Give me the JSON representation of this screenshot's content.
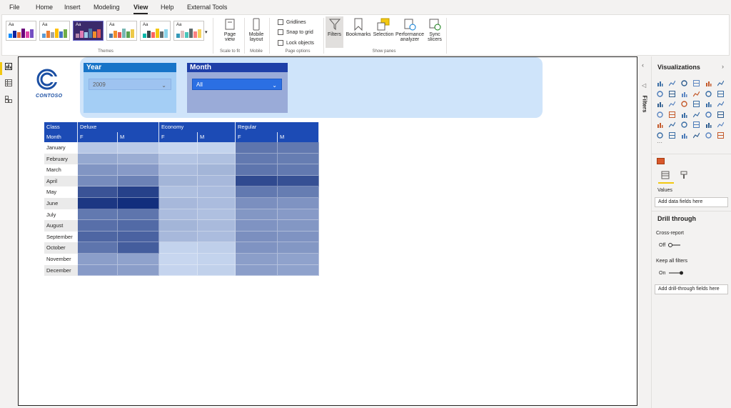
{
  "menu": [
    "File",
    "Home",
    "Insert",
    "Modeling",
    "View",
    "Help",
    "External Tools"
  ],
  "menu_active": "View",
  "ribbon": {
    "themes_label": "Themes",
    "page_view_label": "Page view",
    "scale_label": "Scale to fit",
    "mobile_layout_label": "Mobile layout",
    "mobile_label": "Mobile",
    "page_options_label": "Page options",
    "gridlines_label": "Gridlines",
    "snap_label": "Snap to grid",
    "lock_label": "Lock objects",
    "filters_label": "Filters",
    "bookmarks_label": "Bookmarks",
    "selection_label": "Selection",
    "perf_label": "Performance analyzer",
    "sync_label": "Sync slicers",
    "show_panes_label": "Show panes"
  },
  "logo": {
    "text": "CONTOSO",
    "color": "#1b4fa3"
  },
  "slicers": {
    "year": {
      "title": "Year",
      "value": "2009"
    },
    "month": {
      "title": "Month",
      "value": "All"
    }
  },
  "matrix": {
    "class_header": "Class",
    "month_header": "Month",
    "classes": [
      "Deluxe",
      "Economy",
      "Regular"
    ],
    "sub_columns": [
      "F",
      "M",
      "F",
      "M",
      "F",
      "M"
    ],
    "rows": [
      "January",
      "February",
      "March",
      "April",
      "May",
      "June",
      "July",
      "August",
      "September",
      "October",
      "November",
      "December"
    ],
    "intensity": [
      [
        0.18,
        0.16,
        0.1,
        0.12,
        0.62,
        0.6
      ],
      [
        0.35,
        0.32,
        0.2,
        0.22,
        0.6,
        0.58
      ],
      [
        0.45,
        0.42,
        0.25,
        0.28,
        0.62,
        0.6
      ],
      [
        0.5,
        0.55,
        0.28,
        0.26,
        0.85,
        0.82
      ],
      [
        0.8,
        0.9,
        0.22,
        0.24,
        0.6,
        0.58
      ],
      [
        0.95,
        1.0,
        0.26,
        0.24,
        0.48,
        0.46
      ],
      [
        0.6,
        0.62,
        0.24,
        0.22,
        0.44,
        0.42
      ],
      [
        0.65,
        0.68,
        0.28,
        0.25,
        0.46,
        0.44
      ],
      [
        0.7,
        0.72,
        0.26,
        0.24,
        0.48,
        0.46
      ],
      [
        0.62,
        0.75,
        0.12,
        0.14,
        0.46,
        0.44
      ],
      [
        0.4,
        0.38,
        0.1,
        0.12,
        0.4,
        0.38
      ],
      [
        0.42,
        0.4,
        0.11,
        0.13,
        0.4,
        0.38
      ]
    ]
  },
  "filters_pane": {
    "label": "Filters"
  },
  "viz_pane": {
    "title": "Visualizations",
    "values_label": "Values",
    "add_fields": "Add data fields here",
    "drill_title": "Drill through",
    "cross_report": "Cross-report",
    "off_label": "Off",
    "keep_filters": "Keep all filters",
    "on_label": "On",
    "add_drill": "Add drill-through fields here"
  }
}
